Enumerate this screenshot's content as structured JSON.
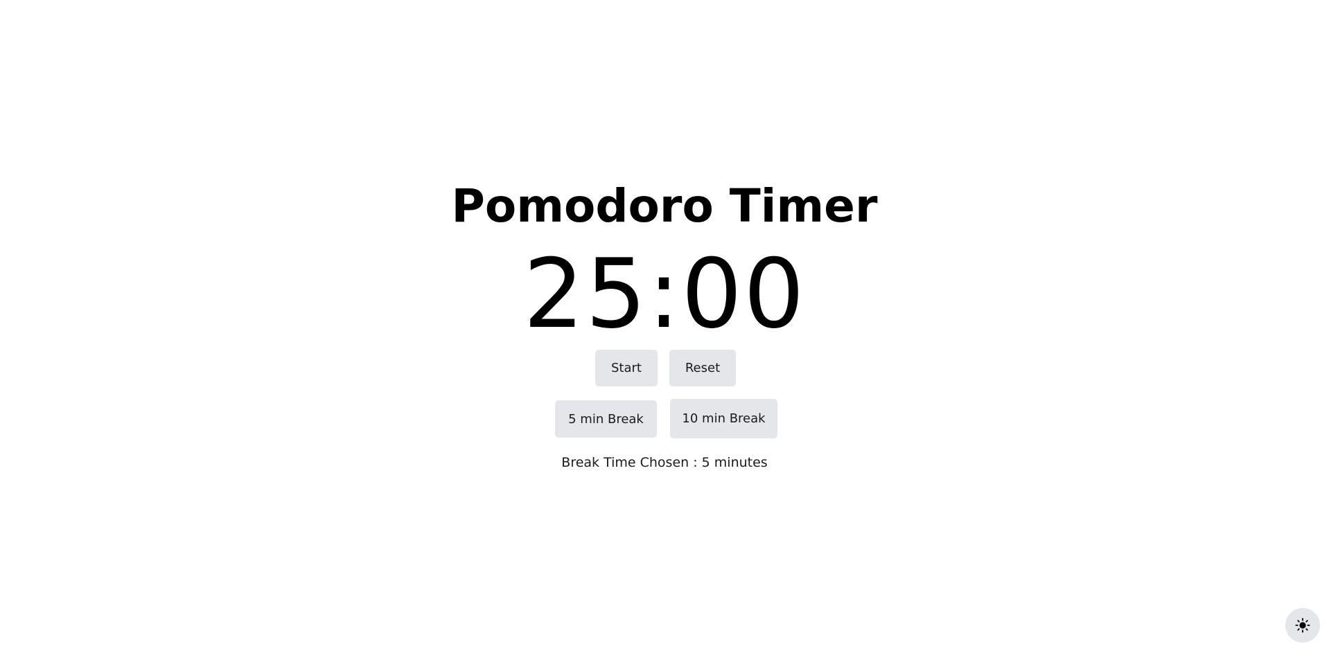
{
  "app": {
    "title": "Pomodoro Timer",
    "timer_display": "25:00"
  },
  "controls": {
    "start_label": "Start",
    "reset_label": "Reset"
  },
  "breaks": {
    "five_label": "5 min Break",
    "ten_label": "10 min Break",
    "chosen_text": "Break Time Chosen : 5 minutes"
  },
  "theme_toggle": {
    "icon": "sun-icon"
  },
  "colors": {
    "background": "#ffffff",
    "text": "#000000",
    "button_bg": "#e5e6ea"
  }
}
